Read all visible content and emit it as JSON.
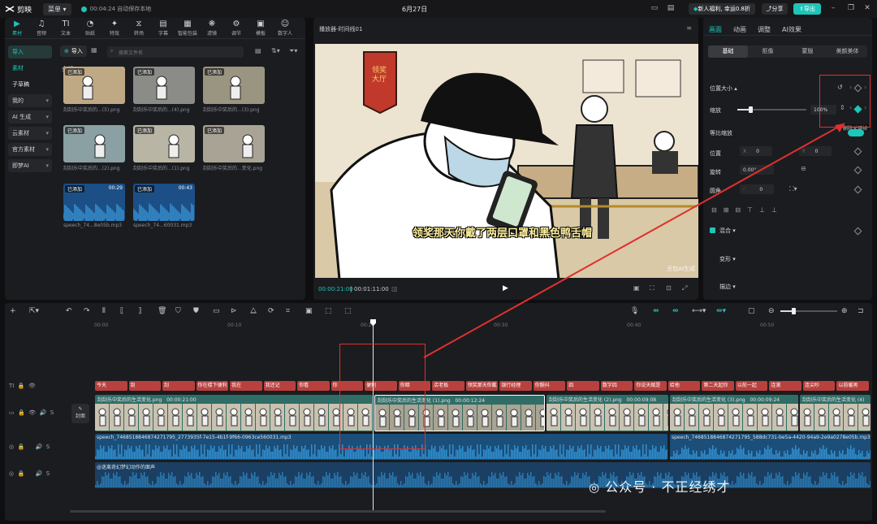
{
  "app": {
    "name": "剪映",
    "menu": "菜单",
    "autosave": "00:04:24 自动保存本地",
    "date": "6月27日",
    "promo": "新人福利, 幸运0.8折",
    "share": "分享",
    "export": "导出"
  },
  "tools": [
    {
      "label": "素材",
      "icon": "media-icon"
    },
    {
      "label": "音频",
      "icon": "audio-icon"
    },
    {
      "label": "文本",
      "icon": "text-icon"
    },
    {
      "label": "贴纸",
      "icon": "sticker-icon"
    },
    {
      "label": "特效",
      "icon": "effects-icon"
    },
    {
      "label": "转场",
      "icon": "transition-icon"
    },
    {
      "label": "字幕",
      "icon": "caption-icon"
    },
    {
      "label": "智能包装",
      "icon": "smart-pack-icon"
    },
    {
      "label": "滤镜",
      "icon": "filter-icon"
    },
    {
      "label": "调节",
      "icon": "adjust-icon"
    },
    {
      "label": "模板",
      "icon": "template-icon"
    },
    {
      "label": "数字人",
      "icon": "avatar-icon"
    }
  ],
  "sidebar": [
    "导入",
    "素材",
    "子草稿",
    "我的",
    "AI 生成",
    "云素材",
    "官方素材",
    "即梦AI"
  ],
  "media": {
    "import": "导入",
    "search_placeholder": "搜索文件名",
    "all": "全部",
    "items": [
      {
        "tag": "已添加",
        "name": "刮刮乐中奖后的...(5).png",
        "dur": ""
      },
      {
        "tag": "已添加",
        "name": "刮刮乐中奖后的...(4).png",
        "dur": ""
      },
      {
        "tag": "已添加",
        "name": "刮刮乐中奖后的...(3).png",
        "dur": ""
      },
      {
        "tag": "已添加",
        "name": "刮刮乐中奖后的...(2).png",
        "dur": ""
      },
      {
        "tag": "已添加",
        "name": "刮刮乐中奖后的...(1).png",
        "dur": ""
      },
      {
        "tag": "已添加",
        "name": "刮刮乐中奖后的...变化.png",
        "dur": ""
      },
      {
        "tag": "已添加",
        "name": "speech_74...8e05b.mp3",
        "dur": "00:29"
      },
      {
        "tag": "已添加",
        "name": "speech_74...60031.mp3",
        "dur": "00:43"
      }
    ]
  },
  "player": {
    "title": "播放器-时间线01",
    "subtitle": "领奖那天你戴了两层口罩和黑色鸭舌帽",
    "sign": "领奖大厅",
    "watermark": "豆包AI生成",
    "current": "00:00:21:00",
    "total": "00:01:11:00"
  },
  "props": {
    "tabs": [
      "画面",
      "动画",
      "调整",
      "AI效果"
    ],
    "subtabs": [
      "基础",
      "抠像",
      "蒙版",
      "美颜美体"
    ],
    "section_pos": "位置大小",
    "scale_label": "缩放",
    "scale_value": "100%",
    "tooltip": "删除关键帧",
    "uniform": "等比缩放",
    "position": "位置",
    "x_label": "X",
    "x_value": "0",
    "y_label": "Y",
    "y_value": "0",
    "rotate": "旋转",
    "rotate_value": "0.00°",
    "mirror": "圆角",
    "mirror_value": "0",
    "blend": "混合",
    "transform": "变形",
    "stroke": "描边"
  },
  "timeline": {
    "ruler": [
      "00:00",
      "00:10",
      "00:20",
      "00:30",
      "00:40",
      "00:50"
    ],
    "cover": "封面",
    "text_clips": [
      "今天",
      "刮",
      "刮",
      "你在楼下便利",
      "我在",
      "我还记",
      "你看",
      "你",
      "便利",
      "你暗",
      "店老板",
      "领奖那天你戴",
      "银行经理",
      "你颤抖",
      "四",
      "数字四",
      "你说天赋是",
      "给他",
      "第二天起你",
      "以前一起",
      "连滚",
      "连尖吵",
      "以前暖男"
    ],
    "video_clips": [
      {
        "name": "刮刮乐中奖后的生活变化.png",
        "time": "00:00:21:00"
      },
      {
        "name": "刮刮乐中奖后的生活变化 (1).png",
        "time": "00:00:12:24"
      },
      {
        "name": "刮刮乐中奖后的生活变化 (2).png",
        "time": "00:00:09:08"
      },
      {
        "name": "刮刮乐中奖后的生活变化 (3).png",
        "time": "00:00:09:24"
      },
      {
        "name": "刮刮乐中奖后的生活变化 (4)",
        "time": ""
      }
    ],
    "audio1_a": "speech_7468518846874271795_2773935f-7e15-4b1f-9f66-0963ce560031.mp3",
    "audio1_b": "speech_7468518846874271795_588dc731-be5a-4420-94a9-2e9a0278e05b.mp3",
    "audio2": "@迷离奇幻梦幻动作的面声"
  },
  "brand_watermark": "公众号 · 不正经绣才",
  "colors": {
    "accent": "#1fc5b7",
    "red": "#e0302f",
    "text_clip": "#b8413d",
    "audio": "#1b6fa8",
    "video": "#2f7b72"
  }
}
